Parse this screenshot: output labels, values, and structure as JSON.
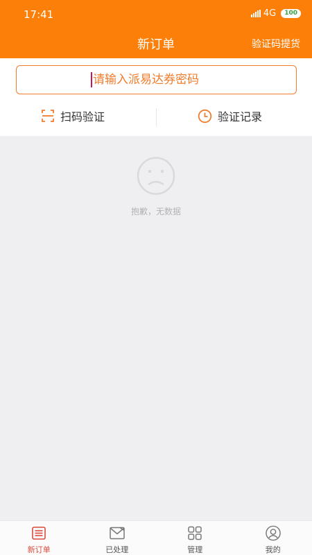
{
  "status": {
    "time": "17:41",
    "network": "4G",
    "battery": "100"
  },
  "header": {
    "title": "新订单",
    "action": "验证码提货"
  },
  "search": {
    "placeholder": "请输入派易达券密码"
  },
  "actions": {
    "scan": "扫码验证",
    "record": "验证记录"
  },
  "empty": {
    "text": "抱歉，无数据"
  },
  "tabs": [
    {
      "label": "新订单",
      "icon": "list-icon",
      "active": true
    },
    {
      "label": "已处理",
      "icon": "envelope-icon"
    },
    {
      "label": "管理",
      "icon": "grid-icon"
    },
    {
      "label": "我的",
      "icon": "person-icon"
    }
  ],
  "colors": {
    "brand": "#fb7f08",
    "accent": "#f07c2c",
    "active_tab": "#d94b3d"
  }
}
